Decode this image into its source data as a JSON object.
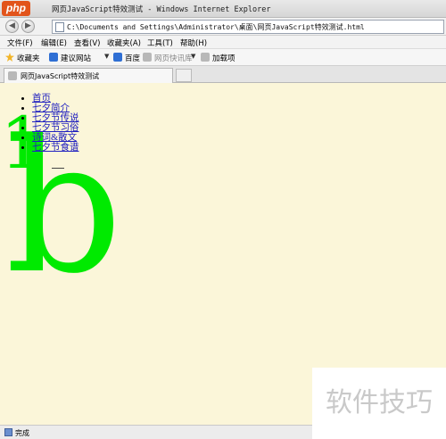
{
  "window": {
    "logo_text": "php",
    "title": "网页JavaScript特效测试 - Windows Internet Explorer"
  },
  "address_bar": {
    "back_glyph": "◀",
    "forward_glyph": "▶",
    "url": "C:\\Documents and Settings\\Administrator\\桌面\\网页JavaScript特效测试.html"
  },
  "menu": {
    "items": [
      "文件(F)",
      "编辑(E)",
      "查看(V)",
      "收藏夹(A)",
      "工具(T)",
      "帮助(H)"
    ]
  },
  "favorites_bar": {
    "favorites_label": "收藏夹",
    "items": [
      "建议网站",
      "百度",
      "网页快讯库",
      "加载项"
    ]
  },
  "tabs": [
    {
      "title": "网页JavaScript特效测试"
    }
  ],
  "page": {
    "big_char_1": "1",
    "big_char_2": "b",
    "nav_items": [
      "首页",
      "七夕简介",
      "七夕节传说",
      "七夕节习俗",
      "诗词&散文",
      "七夕节食谱"
    ]
  },
  "status_bar": {
    "text": "完成"
  },
  "watermark": {
    "text": "软件技巧"
  },
  "colors": {
    "big_letter": "#00ea00",
    "content_background": "#fbf6d9",
    "link": "#2020c0"
  }
}
